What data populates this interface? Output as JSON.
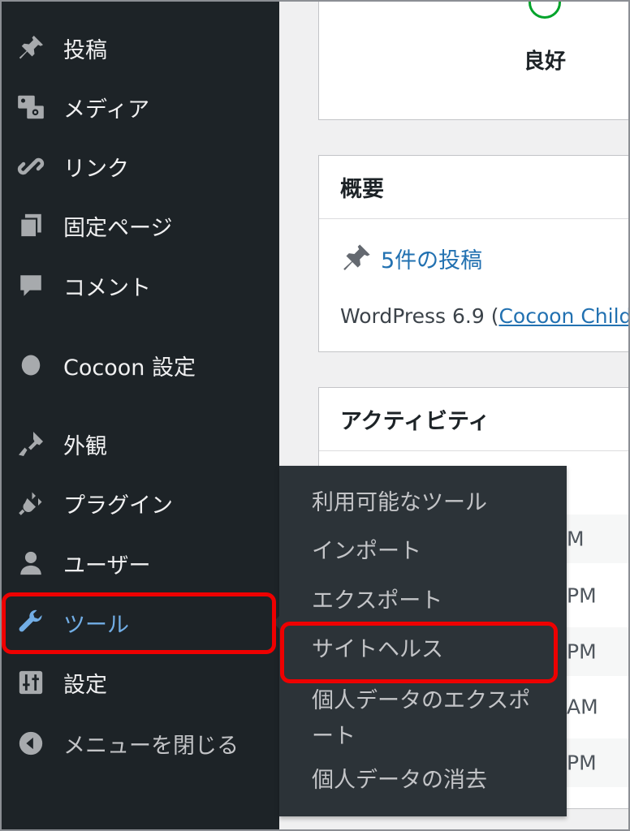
{
  "sidebar": {
    "items": [
      {
        "label": "投稿",
        "icon": "pushpin-icon"
      },
      {
        "label": "メディア",
        "icon": "media-icon"
      },
      {
        "label": "リンク",
        "icon": "link-icon"
      },
      {
        "label": "固定ページ",
        "icon": "pages-icon"
      },
      {
        "label": "コメント",
        "icon": "comment-icon"
      },
      {
        "label": "Cocoon 設定",
        "icon": "circle-icon"
      },
      {
        "label": "外観",
        "icon": "paintbrush-icon"
      },
      {
        "label": "プラグイン",
        "icon": "plugin-icon"
      },
      {
        "label": "ユーザー",
        "icon": "user-icon"
      },
      {
        "label": "ツール",
        "icon": "wrench-icon",
        "active": true
      },
      {
        "label": "設定",
        "icon": "settings-icon"
      },
      {
        "label": "メニューを閉じる",
        "icon": "collapse-icon"
      }
    ]
  },
  "submenu": {
    "items": [
      {
        "label": "利用可能なツール"
      },
      {
        "label": "インポート"
      },
      {
        "label": "エクスポート"
      },
      {
        "label": "サイトヘルス",
        "highlighted": true
      },
      {
        "label": "個人データのエクスポート"
      },
      {
        "label": "個人データの消去"
      }
    ]
  },
  "site_health": {
    "status": "良好"
  },
  "overview": {
    "title": "概要",
    "posts_link": "5件の投稿",
    "version_text": "WordPress 6.9 (",
    "theme_link": "Cocoon Child"
  },
  "activity": {
    "title": "アクティビティ",
    "times": [
      "M",
      "PM",
      "PM",
      "AM",
      "PM"
    ]
  },
  "colors": {
    "sidebar_bg": "#1d2327",
    "submenu_bg": "#2c3338",
    "active_text": "#72aee6",
    "link": "#2271b1",
    "health_good": "#00a32a",
    "highlight": "#e00000"
  }
}
